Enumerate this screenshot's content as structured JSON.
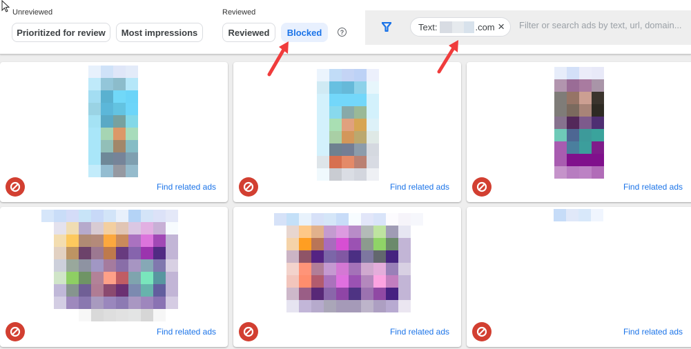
{
  "toolbar": {
    "unreviewed_label": "Unreviewed",
    "reviewed_label": "Reviewed",
    "chips": [
      {
        "label": "Prioritized for review",
        "active": false
      },
      {
        "label": "Most impressions",
        "active": false
      },
      {
        "label": "Reviewed",
        "active": false
      },
      {
        "label": "Blocked",
        "active": true
      }
    ],
    "help_icon": "?"
  },
  "filter": {
    "icon": "filter-icon",
    "chip_prefix": "Text:",
    "chip_suffix": ".com",
    "chip_close": "×",
    "placeholder": "Filter or search ads by text, url, domain..."
  },
  "colors": {
    "accent": "#1a73e8",
    "active_chip_bg": "#e8f0fe",
    "block_icon": "#d23f31",
    "annotation_arrow": "#f03c3c"
  },
  "cards": [
    {
      "link": "Find related ads",
      "status_icon": "blocked-icon",
      "thumb": {
        "cols": 4,
        "pixels": [
          "#e7f1fc",
          "#cfe2f8",
          "#dfe6f8",
          "#e3ebf9",
          "#bfeafa",
          "#93c6d9",
          "#8cbccb",
          "#b5e7f9",
          "#a3ddf2",
          "#5ab1d0",
          "#71d8f8",
          "#6bd4f8",
          "#9ad3e4",
          "#5cb7d9",
          "#63c3e1",
          "#6dd5f9",
          "#a4e2f4",
          "#5aa9c5",
          "#77a19f",
          "#83d8e8",
          "#a9e6f9",
          "#a6d5b3",
          "#dc9868",
          "#a8dcbb",
          "#a9e6f9",
          "#92bfb8",
          "#a2876a",
          "#85bcc5",
          "#a9e6f9",
          "#6f8898",
          "#768499",
          "#7f9fb0",
          "#c3ecfb",
          "#94bdd1",
          "#9699a1",
          "#95bbcc"
        ]
      }
    },
    {
      "link": "Find related ads",
      "status_icon": "blocked-icon",
      "thumb": {
        "cols": 5,
        "pixels": [
          "#ebf4fd",
          "#c1dcf7",
          "#c4d4f5",
          "#bdd2f6",
          "#ecf0fc",
          "#d0eaf4",
          "#67c0e1",
          "#66b9d9",
          "#8dd2ea",
          "#e7f6fc",
          "#d3f1fc",
          "#73d7fa",
          "#73d7fa",
          "#73d7fa",
          "#d3f1fc",
          "#d3f1fc",
          "#88d9ed",
          "#88a9a8",
          "#9ab997",
          "#d3f1fc",
          "#d3f1fc",
          "#a9dfb3",
          "#e0a17e",
          "#d7a553",
          "#ddf1f8",
          "#d3f1fc",
          "#a9cfa5",
          "#d3975a",
          "#bba86e",
          "#dfe9e6",
          "#d3f1fc",
          "#6f8190",
          "#747e94",
          "#8c9cab",
          "#d5d9e0",
          "#dee5e9",
          "#d77050",
          "#e48a68",
          "#ba8173",
          "#d8dbe3",
          "#f0f9fd",
          "#c9ccd2",
          "#dadde4",
          "#d3d6de",
          "#eef0f4"
        ]
      }
    },
    {
      "link": "Find related ads",
      "status_icon": "blocked-icon",
      "thumb": {
        "cols": 4,
        "pixels": [
          "#e7edfa",
          "#d3e0f8",
          "#ebecf9",
          "#e8e9f8",
          "#b295ae",
          "#9a6c96",
          "#a97ba0",
          "#a995a8",
          "#7f7c78",
          "#967466",
          "#cc9f92",
          "#3b342d",
          "#7f7c78",
          "#7b6a5e",
          "#a88478",
          "#2e2a23",
          "#87728e",
          "#53285a",
          "#7d5a8c",
          "#4e2e72",
          "#6ecab8",
          "#4d6793",
          "#3d9a9a",
          "#3aa39c",
          "#a85cb0",
          "#4a7f9e",
          "#3c9e9c",
          "#7f1c8a",
          "#a85cb0",
          "#80108c",
          "#80108c",
          "#80108c",
          "#c593ca",
          "#b77cc0",
          "#bc82c4",
          "#b16cb8"
        ]
      }
    },
    {
      "link": "Find related ads",
      "status_icon": "blocked-icon",
      "thumb": {
        "cols": 11,
        "pixels": [
          "#d6e6fa",
          "#c9ddf8",
          "#d4dcf8",
          "#c8e4f8",
          "#c8d9f8",
          "#d2e4f8",
          "#e8f0fb",
          "#b4d3f6",
          "#d4e4f8",
          "#dce2f8",
          "#e4e8f8",
          "#ffffff",
          "#e4e2ee",
          "#f0ddb3",
          "#b6aacc",
          "#d8cbd3",
          "#f3cfa0",
          "#e1c5b4",
          "#dac7e3",
          "#e2b0e2",
          "#c8b0d6",
          "#f7fbfe",
          "#ffffff",
          "#f3ddb0",
          "#fdc95e",
          "#b08b74",
          "#b48a7a",
          "#fca83e",
          "#c98a5c",
          "#aa72c0",
          "#dc74dc",
          "#a148b5",
          "#c2b5d6",
          "#ffffff",
          "#e2d1c2",
          "#bd9463",
          "#6c426a",
          "#9c7891",
          "#be7a4c",
          "#673a7f",
          "#8664ad",
          "#9b34ae",
          "#512b83",
          "#c2b5d6",
          "#ffffff",
          "#cdd0db",
          "#99a89c",
          "#8e93a2",
          "#a197c4",
          "#a57b9e",
          "#896ea8",
          "#a795c2",
          "#86a8b6",
          "#8078ae",
          "#d8d0e3",
          "#ffffff",
          "#d0e5c8",
          "#8ecf63",
          "#6f9465",
          "#b28298",
          "#fea088",
          "#c05d64",
          "#7fa4ae",
          "#79e6bc",
          "#5896a0",
          "#c2b5d6",
          "#ffffff",
          "#c0b8d8",
          "#86958e",
          "#705f96",
          "#b07c94",
          "#8b4a70",
          "#6b3072",
          "#7c8ab0",
          "#67b3ac",
          "#625e9e",
          "#c2b5d6",
          "#ffffff",
          "#d3cde3",
          "#9e89bd",
          "#8a78b0",
          "#a89abf",
          "#9a87bd",
          "#8d7ab3",
          "#a997c2",
          "#9e86bd",
          "#8a73b3",
          "#d5cce3",
          "#ffffff",
          "#ffffff",
          "#ffffff",
          "#f7f7f7",
          "#d9d9d9",
          "#dedede",
          "#e1e1e1",
          "#e3e4e4",
          "#d6d6d6",
          "#f6f6f6",
          "#ffffff"
        ]
      }
    },
    {
      "link": "Find related ads",
      "status_icon": "blocked-icon",
      "thumb": {
        "cols": 12,
        "pixels": [
          "#d6e2f8",
          "#c4e0f8",
          "#e8f2fc",
          "#d7e1f8",
          "#d5e6f8",
          "#c8dcf8",
          "#f7fcff",
          "#e2e6f9",
          "#d9e4f9",
          "#fcfbfe",
          "#f6f4fa",
          "#f6f7fc",
          "#ffffff",
          "#e8d6cf",
          "#fec887",
          "#e1b18c",
          "#c49bd0",
          "#dc9be0",
          "#b88cc8",
          "#b3bbb8",
          "#bee4a0",
          "#a09cb5",
          "#e6e6f2",
          "#ffffff",
          "#ffffff",
          "#f5d3a8",
          "#ff9e22",
          "#b97557",
          "#a86cbd",
          "#d74fd3",
          "#9b52b3",
          "#8c9b8e",
          "#8fd467",
          "#6b8a6b",
          "#c2b5d6",
          "#ffffff",
          "#ffffff",
          "#cbb4c5",
          "#8f5467",
          "#542383",
          "#7c66a8",
          "#8158a3",
          "#4b2f83",
          "#7d77a0",
          "#62676e",
          "#45237f",
          "#c2b5d6",
          "#ffffff",
          "#ffffff",
          "#f3d3cc",
          "#ff9478",
          "#b17e98",
          "#c599d1",
          "#d478d4",
          "#a472b8",
          "#d0a9cf",
          "#e4addb",
          "#9980b8",
          "#d8d0e3",
          "#ffffff",
          "#ffffff",
          "#f2c5bc",
          "#ff8d6d",
          "#b25b6e",
          "#aa72bc",
          "#df70df",
          "#9b52b3",
          "#b488bd",
          "#fca3e1",
          "#c27ebf",
          "#c2b5d6",
          "#ffffff",
          "#ffffff",
          "#cdb8ca",
          "#9a5e86",
          "#582877",
          "#8a66aa",
          "#8f45a6",
          "#4e3383",
          "#9c72b0",
          "#9049a4",
          "#462181",
          "#c2b5d6",
          "#ffffff",
          "#ffffff",
          "#e6e4f1",
          "#c2b6d8",
          "#b6aacc",
          "#aaa6b8",
          "#a59ab8",
          "#a59ab8",
          "#bdb4ca",
          "#ad9fc2",
          "#b8aad1",
          "#ebe6f1",
          "#ffffff"
        ]
      }
    },
    {
      "link": "Find related ads",
      "status_icon": "blocked-icon",
      "thumb": {
        "cols": 4,
        "pixels": [
          "#c6dcf8",
          "#e0e8f9",
          "#d8e8fa",
          "#f0f5fe"
        ]
      }
    }
  ]
}
